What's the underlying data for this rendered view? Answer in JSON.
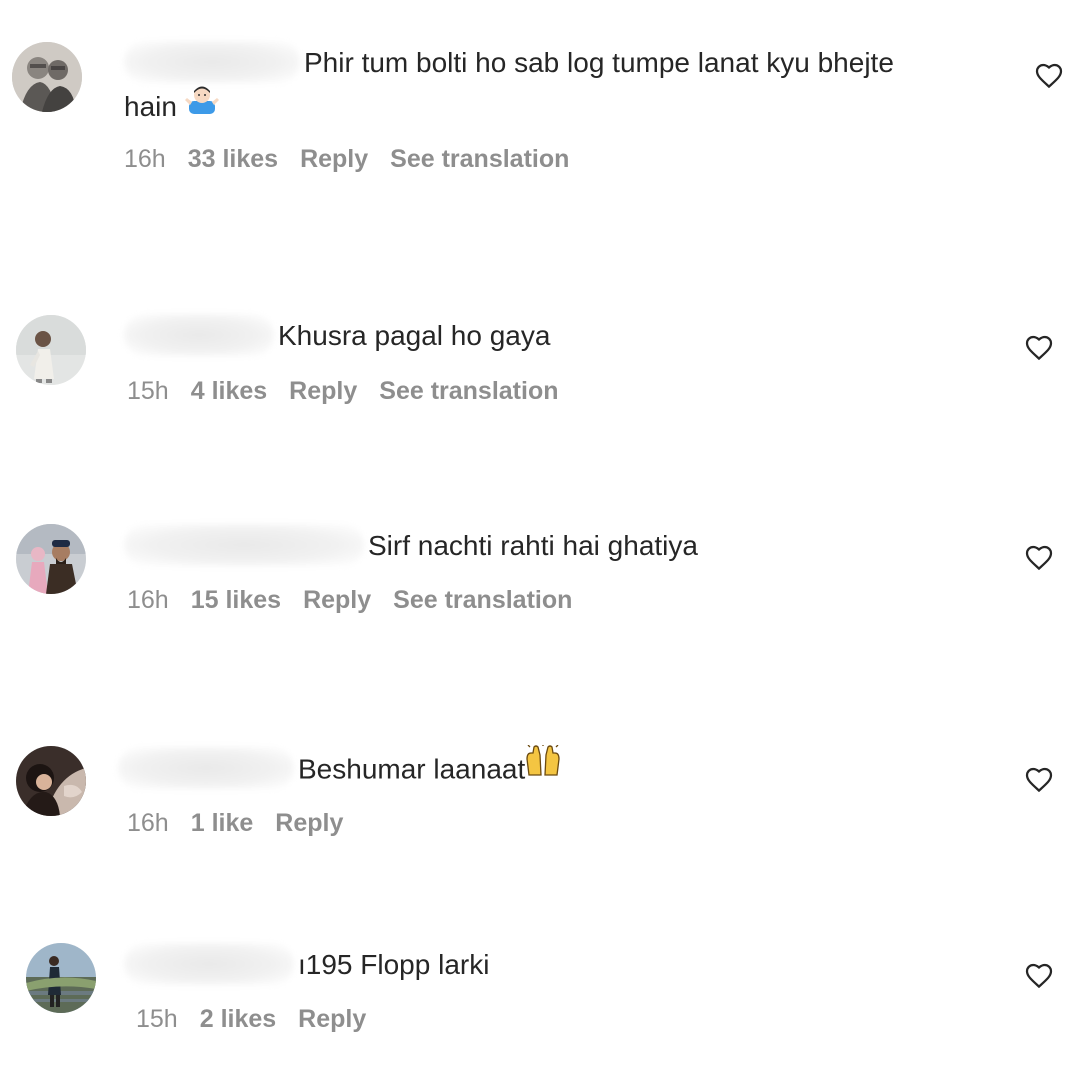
{
  "comments": [
    {
      "username_visible": "",
      "text_line1": "Phir tum bolti ho sab log tumpe lanat kyu bhejte",
      "text_line2": "hain",
      "emoji": "person-shrugging-emoji",
      "time": "16h",
      "likes": "33 likes",
      "reply": "Reply",
      "translation": "See translation"
    },
    {
      "username_visible": "",
      "text": "Khusra pagal ho gaya",
      "time": "15h",
      "likes": "4 likes",
      "reply": "Reply",
      "translation": "See translation"
    },
    {
      "username_visible": "",
      "text": "Sirf nachti rahti hai ghatiya",
      "time": "16h",
      "likes": "15 likes",
      "reply": "Reply",
      "translation": "See translation"
    },
    {
      "username_visible": "",
      "text": "Beshumar laanaat",
      "emoji": "raising-hands-emoji",
      "time": "16h",
      "likes": "1 like",
      "reply": "Reply"
    },
    {
      "username_visible": "ı195",
      "text": "Flopp larki",
      "time": "15h",
      "likes": "2 likes",
      "reply": "Reply"
    }
  ],
  "colors": {
    "text": "#262626",
    "meta": "#8e8e8e",
    "background": "#ffffff"
  },
  "icons": {
    "like": "heart-outline-icon"
  }
}
